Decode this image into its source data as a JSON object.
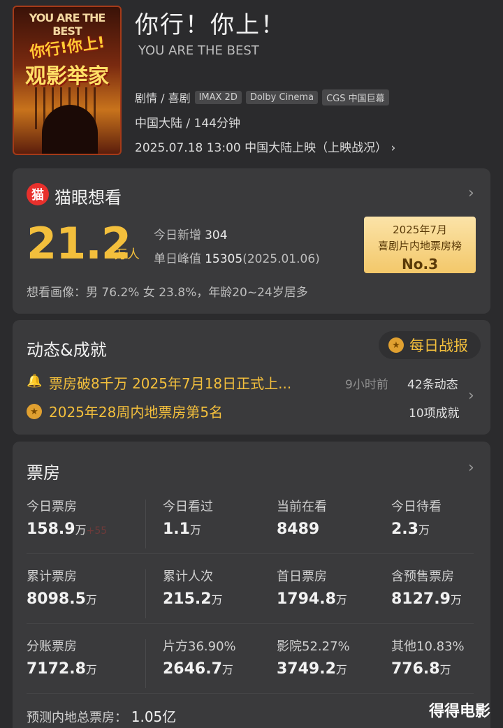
{
  "movie": {
    "title_cn": "你行！你上！",
    "title_en": "YOU ARE THE BEST",
    "poster_top_text": "YOU ARE THE BEST",
    "poster_red_text": "你行!你上!",
    "poster_main_text": "观影举家",
    "genre": "剧情 / 喜剧",
    "tags": [
      "IMAX 2D",
      "Dolby Cinema",
      "CGS 中国巨幕"
    ],
    "region_duration": "中国大陆 / 144分钟",
    "release": "2025.07.18 13:00  中国大陆上映（上映战况）",
    "release_chevron": "›"
  },
  "want": {
    "logo": "猫",
    "title": "猫眼想看",
    "chevron": "›",
    "count": "21.2",
    "unit": "万人",
    "today_label": "今日新增",
    "today_value": "304",
    "peak_label": "单日峰值",
    "peak_value": "15305",
    "peak_date": "(2025.01.06)",
    "rank_line1": "2025年7月",
    "rank_line2": "喜剧片内地票房榜",
    "rank_line3": "No.3",
    "audience": "想看画像：男 76.2%  女 23.8%，年龄20~24岁居多"
  },
  "news": {
    "title": "动态&成就",
    "daily_button": "每日战报",
    "daily_icon": "★",
    "item1_icon": "🔔",
    "item1_text": "票房破8千万 2025年7月18日正式上...",
    "item1_time": "9小时前",
    "item1_count": "42条动态",
    "item2_icon": "★",
    "item2_text": "2025年28周内地票房第5名",
    "item2_count": "10项成就",
    "chevron": "›"
  },
  "boxoffice": {
    "title": "票房",
    "chevron": "›",
    "row1": [
      {
        "label": "今日票房",
        "value": "158.9",
        "unit": "万",
        "extra": "+55"
      },
      {
        "label": "今日看过",
        "value": "1.1",
        "unit": "万"
      },
      {
        "label": "当前在看",
        "value": "8489",
        "unit": ""
      },
      {
        "label": "今日待看",
        "value": "2.3",
        "unit": "万"
      }
    ],
    "row2": [
      {
        "label": "累计票房",
        "value": "8098.5",
        "unit": "万"
      },
      {
        "label": "累计人次",
        "value": "215.2",
        "unit": "万"
      },
      {
        "label": "首日票房",
        "value": "1794.8",
        "unit": "万"
      },
      {
        "label": "含预售票房",
        "value": "8127.9",
        "unit": "万"
      }
    ],
    "row3": [
      {
        "label": "分账票房",
        "value": "7172.8",
        "unit": "万"
      },
      {
        "label": "片方36.90%",
        "value": "2646.7",
        "unit": "万"
      },
      {
        "label": "影院52.27%",
        "value": "3749.2",
        "unit": "万"
      },
      {
        "label": "其他10.83%",
        "value": "776.8",
        "unit": "万"
      }
    ],
    "forecast_label": "预测内地总票房：",
    "forecast_value": "1.05亿"
  },
  "watermark": "得得电影",
  "colors": {
    "accent": "#f3bf3c",
    "card": "#3a3a3c",
    "bg": "#2b2b2d"
  }
}
